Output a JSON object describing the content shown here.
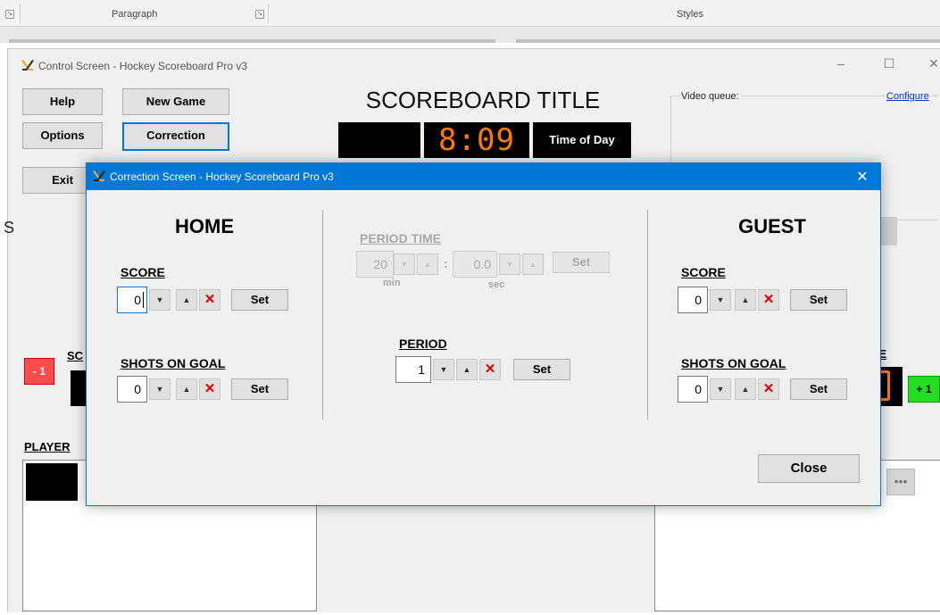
{
  "ribbon": {
    "paragraph_label": "Paragraph",
    "styles_label": "Styles",
    "launcher_glyph": "↘"
  },
  "control_window": {
    "title": "Control Screen - Hockey Scoreboard Pro v3",
    "buttons": {
      "help": "Help",
      "new_game": "New Game",
      "options": "Options",
      "correction": "Correction",
      "exit": "Exit"
    },
    "scoreboard_title": "SCOREBOARD TITLE",
    "clock": "8:09",
    "time_of_day": "Time of Day",
    "video_queue_label": "Video queue:",
    "configure_link": "Configure",
    "home_score_label_partial": "SC",
    "guest_score_label_partial": "RE",
    "minus_one": "- 1",
    "plus_one": "+ 1",
    "player_label": "PLAYER",
    "more_button": "•••",
    "left_edge_char": "S",
    "window_controls": {
      "minimize": "–",
      "maximize": "☐",
      "close": "✕"
    }
  },
  "correction_dialog": {
    "title": "Correction Screen - Hockey Scoreboard Pro v3",
    "close_x": "✕",
    "home": {
      "heading": "HOME",
      "score": {
        "label": "SCORE",
        "value": "0",
        "set": "Set"
      },
      "shots": {
        "label": "SHOTS ON GOAL",
        "value": "0",
        "set": "Set"
      }
    },
    "middle": {
      "period_time": {
        "label": "PERIOD TIME",
        "min_value": "20",
        "sec_value": "0.0",
        "colon": ":",
        "min_label": "min",
        "sec_label": "sec",
        "set": "Set"
      },
      "period": {
        "label": "PERIOD",
        "value": "1",
        "set": "Set"
      }
    },
    "guest": {
      "heading": "GUEST",
      "score": {
        "label": "SCORE",
        "value": "0",
        "set": "Set"
      },
      "shots": {
        "label": "SHOTS ON GOAL",
        "value": "0",
        "set": "Set"
      }
    },
    "close_button": "Close",
    "spin_down_glyph": "▼",
    "spin_up_glyph": "▲",
    "clear_glyph": "✕"
  },
  "colors": {
    "accent": "#0078d7",
    "clock_digits": "#ff7a00",
    "minus_button": "#ff4d4d",
    "plus_button": "#22dd22",
    "clear_x": "#e00000"
  }
}
